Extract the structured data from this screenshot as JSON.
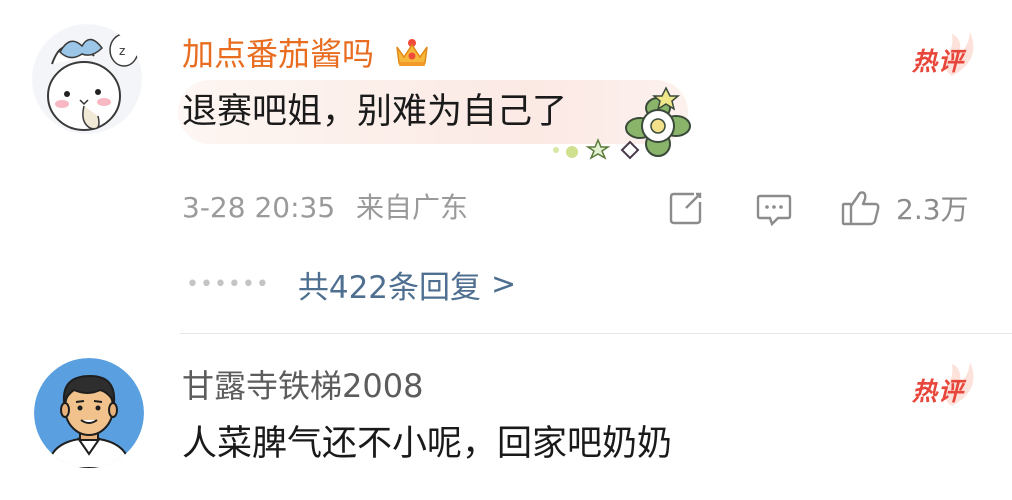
{
  "comments": [
    {
      "username": "加点番茄酱吗",
      "username_color": "#e86d20",
      "badge": "热评",
      "text": "退赛吧姐，别难为自己了",
      "date": "3-28 20:35",
      "location": "来自广东",
      "like_count": "2.3万",
      "replies_text": "共422条回复",
      "replies_arrow": ">",
      "avatar_icon": "cartoon-cat-avatar",
      "crown_icon": "crown-icon"
    },
    {
      "username": "甘露寺铁梯2008",
      "username_color": "#5c5c5c",
      "badge": "热评",
      "text": "人菜脾气还不小呢，回家吧奶奶",
      "avatar_icon": "cartoon-man-avatar"
    }
  ],
  "colors": {
    "badge": "#e8463a",
    "link": "#4f6f91",
    "meta": "#9a9a9a"
  }
}
